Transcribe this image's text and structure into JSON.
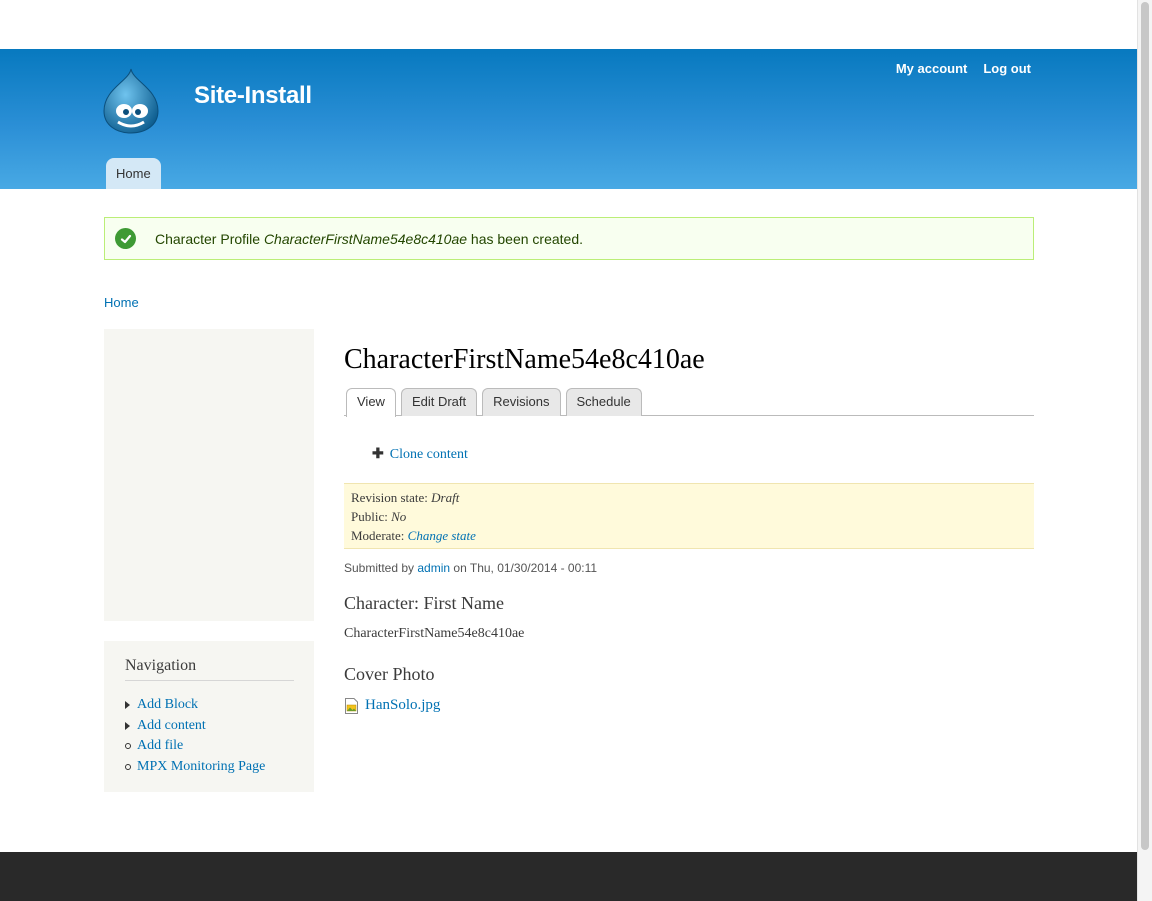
{
  "header": {
    "site_name": "Site-Install",
    "secondary_menu": [
      "My account",
      "Log out"
    ],
    "main_menu": [
      "Home"
    ]
  },
  "status": {
    "prefix": "Character Profile ",
    "title": "CharacterFirstName54e8c410ae",
    "suffix": " has been created."
  },
  "breadcrumb": "Home",
  "sidebar": {
    "navigation_title": "Navigation",
    "items": [
      {
        "label": "Add Block",
        "bullet": "triangle"
      },
      {
        "label": "Add content",
        "bullet": "triangle"
      },
      {
        "label": "Add file",
        "bullet": "circle"
      },
      {
        "label": "MPX Monitoring Page",
        "bullet": "circle"
      }
    ]
  },
  "content": {
    "title": "CharacterFirstName54e8c410ae",
    "tabs": [
      "View",
      "Edit Draft",
      "Revisions",
      "Schedule"
    ],
    "active_tab": "View",
    "action_link": "Clone content",
    "moderation": {
      "revision_state_label": "Revision state: ",
      "revision_state_value": "Draft",
      "public_label": "Public: ",
      "public_value": "No",
      "moderate_label": "Moderate: ",
      "moderate_link": "Change state"
    },
    "submitted": {
      "prefix": "Submitted by ",
      "user": "admin",
      "suffix": " on Thu, 01/30/2014 - 00:11"
    },
    "fields": [
      {
        "label": "Character: First Name",
        "value": "CharacterFirstName54e8c410ae"
      },
      {
        "label": "Cover Photo",
        "file": "HanSolo.jpg"
      }
    ]
  },
  "colors": {
    "header_top": "#0779bf",
    "header_bottom": "#48a9e4",
    "link": "#0071b3",
    "status_bg": "#f8fff0",
    "moderation_bg": "#fffadb",
    "footer_bg": "#292929"
  }
}
